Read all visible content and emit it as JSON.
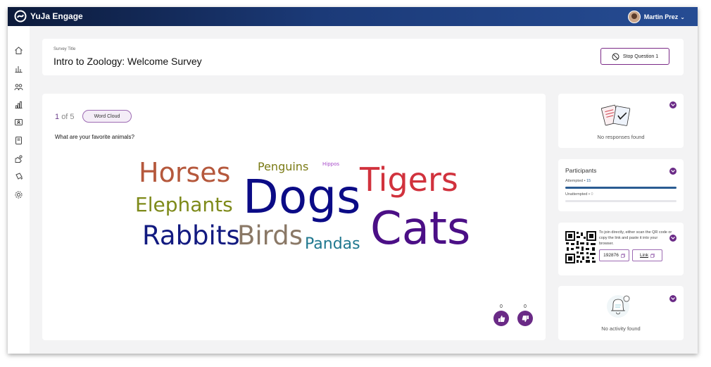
{
  "app": {
    "name": "YuJa Engage"
  },
  "user": {
    "name": "Martin Prez"
  },
  "survey": {
    "label": "Survey Title",
    "title": "Intro to Zoology: Welcome Survey",
    "stop_button": "Stop Question 1"
  },
  "question": {
    "current": "1",
    "of_text": "of 5",
    "type": "Word Cloud",
    "text": "What are your favorite animals?",
    "likes": "0",
    "dislikes": "0"
  },
  "word_cloud": [
    {
      "word": "Horses",
      "color": "#b5583c"
    },
    {
      "word": "Penguins",
      "color": "#7a7a14"
    },
    {
      "word": "Hippos",
      "color": "#a64ac9"
    },
    {
      "word": "Tigers",
      "color": "#d1323d"
    },
    {
      "word": "Dogs",
      "color": "#0b0b86"
    },
    {
      "word": "Elephants",
      "color": "#7e8a1a"
    },
    {
      "word": "Cats",
      "color": "#4b0f86"
    },
    {
      "word": "Rabbits",
      "color": "#121a80"
    },
    {
      "word": "Birds",
      "color": "#8a7866"
    },
    {
      "word": "Pandas",
      "color": "#20788f"
    }
  ],
  "responses_panel": {
    "empty_text": "No responses found"
  },
  "participants_panel": {
    "title": "Participants",
    "attempted_label": "Attempted",
    "attempted_count": "15",
    "unattempted_label": "Unattempted",
    "unattempted_count": "0",
    "attempted_fraction": 1.0
  },
  "join_panel": {
    "instructions": "To join directly, either scan the QR code or copy the link and paste it into your browser.",
    "code": "192876",
    "link_label": "Link"
  },
  "activity_panel": {
    "empty_text": "No activity found"
  },
  "colors": {
    "accent": "#6a2a86",
    "topbar_dark": "#0c1a3a",
    "topbar_light": "#264c93",
    "progress": "#2a5c92"
  },
  "sidebar": {
    "icons": [
      "home-icon",
      "bar-chart-icon",
      "people-icon",
      "analytics-icon",
      "id-card-icon",
      "book-icon",
      "puzzle-icon",
      "paint-bucket-icon",
      "gear-icon"
    ]
  }
}
